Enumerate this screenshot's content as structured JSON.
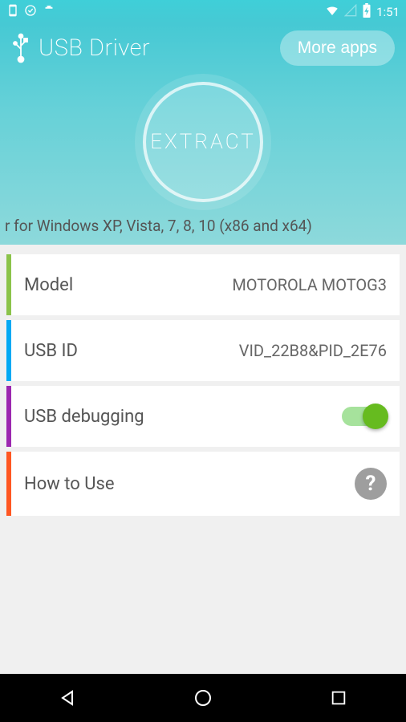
{
  "status": {
    "time": "1:51"
  },
  "header": {
    "title": "USB Driver",
    "more_apps": "More apps",
    "extract": "EXTRACT",
    "subtitle": "r for Windows XP, Vista, 7, 8, 10 (x86 and x64)"
  },
  "rows": {
    "model": {
      "label": "Model",
      "value": "MOTOROLA MOTOG3"
    },
    "usbid": {
      "label": "USB ID",
      "value": "VID_22B8&PID_2E76"
    },
    "debug": {
      "label": "USB debugging"
    },
    "howto": {
      "label": "How to Use"
    }
  }
}
